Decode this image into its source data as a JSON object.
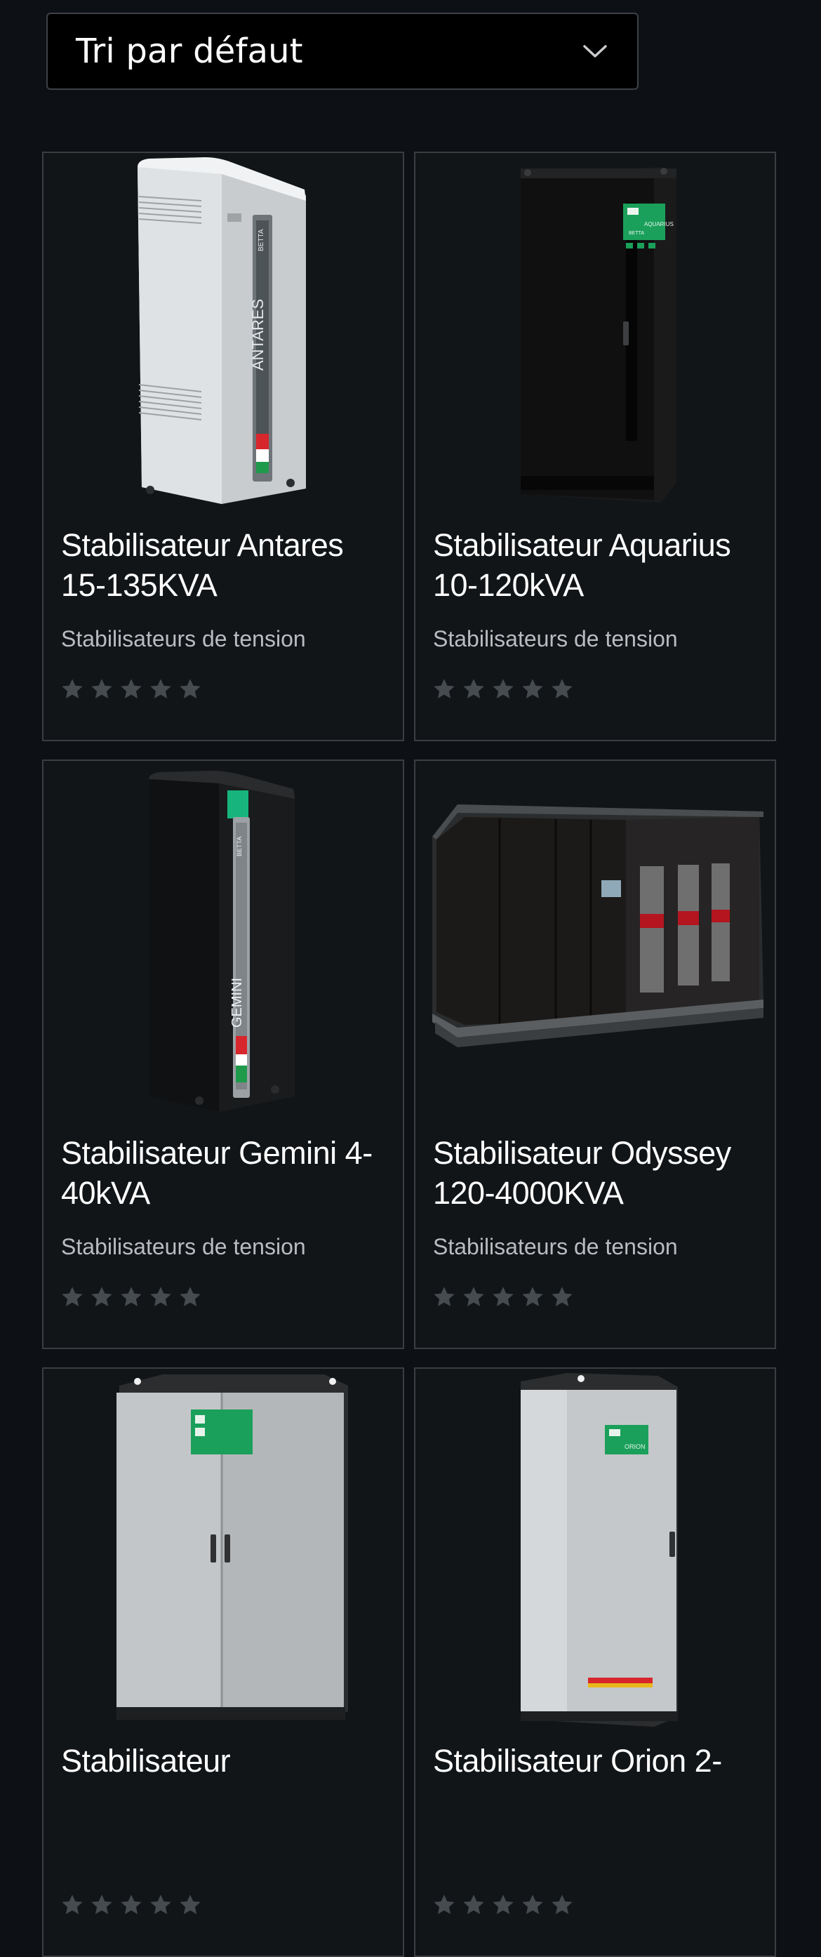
{
  "sort": {
    "label": "Tri par défaut"
  },
  "products": [
    {
      "title": "Stabilisateur Antares 15-135KVA",
      "category": "Stabilisateurs de tension",
      "rating": 0,
      "brand_text": "BETTA",
      "model_text": "ANTARES"
    },
    {
      "title": "Stabilisateur Aquarius 10-120kVA",
      "category": "Stabilisateurs de tension",
      "rating": 0,
      "brand_text": "BETTA",
      "model_text": "AQUARIUS"
    },
    {
      "title": "Stabilisateur Gemini 4-40kVA",
      "category": "Stabilisateurs de tension",
      "rating": 0,
      "brand_text": "BETTA",
      "model_text": "GEMINI"
    },
    {
      "title": "Stabilisateur Odyssey 120-4000KVA",
      "category": "Stabilisateurs de tension",
      "rating": 0
    },
    {
      "title": "Stabilisateur",
      "category": "",
      "rating": 0
    },
    {
      "title": "Stabilisateur Orion 2-",
      "category": "",
      "rating": 0,
      "model_text": "ORION"
    }
  ],
  "colors": {
    "background": "#0d1015",
    "card": "#121518",
    "star": "#464b50",
    "accent_green": "#1aa05a"
  }
}
